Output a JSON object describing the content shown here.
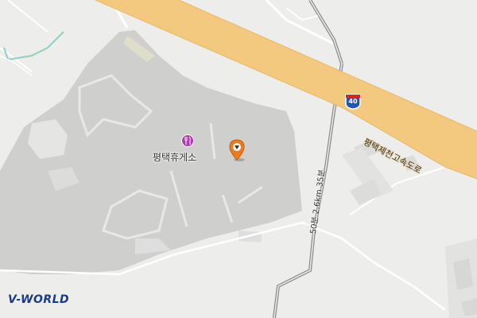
{
  "map": {
    "poi": {
      "label": "평택휴게소",
      "icon": "restaurant-icon"
    },
    "highway": {
      "label": "평택제천고속도로",
      "shield_number": "40",
      "color": "#f2c97f"
    },
    "side_road": {
      "label": "50분 2.6km 35분"
    },
    "marker": {
      "icon": "location-pin-icon",
      "color": "#f07a1b"
    },
    "brand": {
      "logo_text": "V-WORLD"
    }
  }
}
